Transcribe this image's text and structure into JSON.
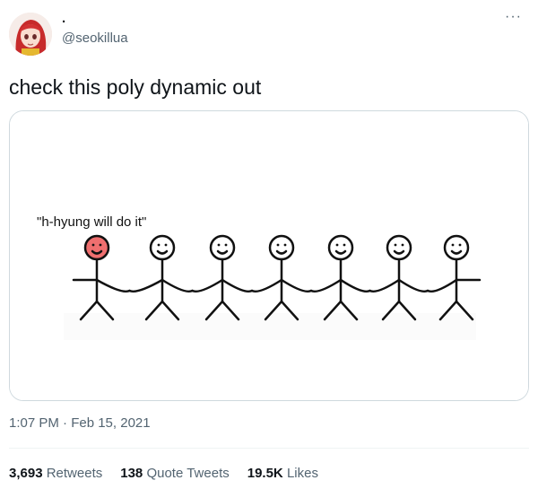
{
  "tweet": {
    "display_name": ".",
    "handle": "@seokillua",
    "more_label": "···",
    "text": "check this poly dynamic out",
    "timestamp": "1:07 PM · Feb 15, 2021"
  },
  "image": {
    "caption": "\"h-hyung will do it\"",
    "highlight_color": "#ef6f6f"
  },
  "stats": [
    {
      "value": "3,693",
      "label": "Retweets"
    },
    {
      "value": "138",
      "label": "Quote Tweets"
    },
    {
      "value": "19.5K",
      "label": "Likes"
    }
  ]
}
